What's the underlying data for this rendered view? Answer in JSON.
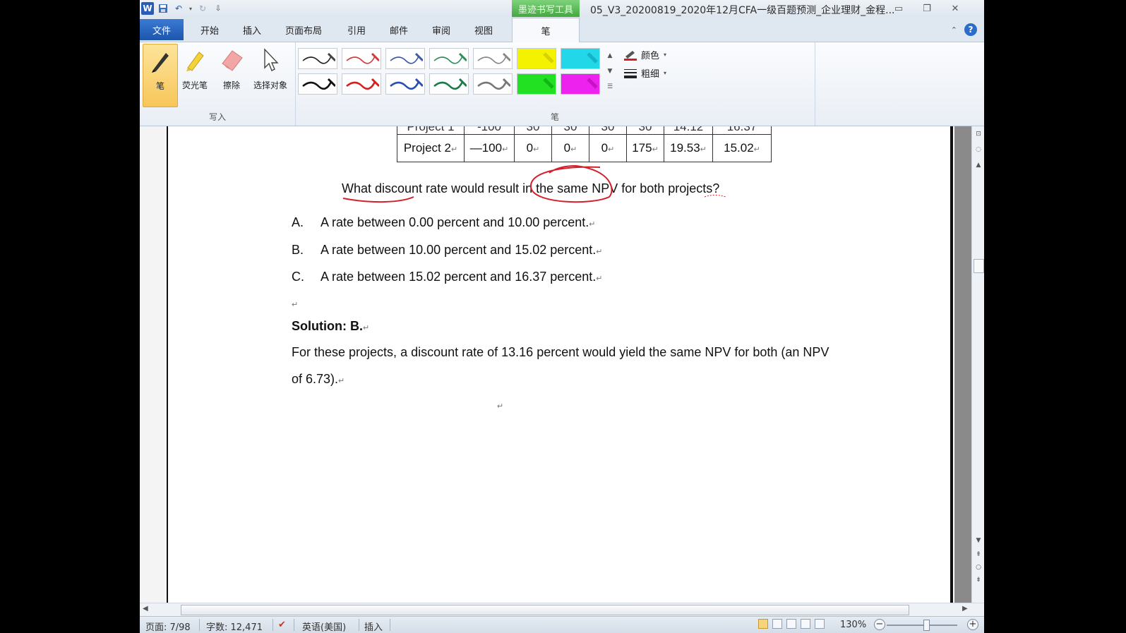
{
  "titlebar": {
    "context_tab": "墨迹书写工具",
    "doc_title": "05_V3_20200819_2020年12月CFA一级百题预测_企业理财_金程..."
  },
  "tabs": {
    "file": "文件",
    "items": [
      "开始",
      "插入",
      "页面布局",
      "引用",
      "邮件",
      "审阅",
      "视图"
    ],
    "active": "笔"
  },
  "ribbon": {
    "write_group": {
      "label": "写入",
      "tools": [
        "笔",
        "荧光笔",
        "擦除",
        "选择对象"
      ]
    },
    "pen_group": {
      "label": "笔",
      "color_label": "颜色",
      "weight_label": "粗细"
    },
    "swatch_colors": {
      "pens_row1": [
        "#222222",
        "#d23a3a",
        "#3a5aa8",
        "#2f8f5a",
        "#888888"
      ],
      "pens_row2": [
        "#111111",
        "#d41f1f",
        "#2a4fb0",
        "#1b7a4a",
        "#777777"
      ],
      "highlighters_row1": [
        "#f5f200",
        "#22d7e8"
      ],
      "highlighters_row2": [
        "#22e022",
        "#ee22ee"
      ]
    }
  },
  "document": {
    "table_partial_row": [
      "Project 1",
      "-100",
      "30",
      "30",
      "30",
      "30",
      "14.12",
      "16.37"
    ],
    "table_row": [
      "Project 2",
      "—100",
      "0",
      "0",
      "0",
      "175",
      "19.53",
      "15.02"
    ],
    "question": {
      "before": "What ",
      "underlined": "discount rate",
      "middle": " would result in th",
      "circle_start": "e",
      "circled": " same NPV",
      "circle_end": " f",
      "after": "or both projects?"
    },
    "options": [
      {
        "letter": "A.",
        "text": "A rate between 0.00 percent and 10.00 percent."
      },
      {
        "letter": "B.",
        "text": "A rate between 10.00 percent and 15.02 percent."
      },
      {
        "letter": "C.",
        "text": "A rate between 15.02 percent and 16.37 percent."
      }
    ],
    "solution": "Solution: B.",
    "explanation_line1": "For these projects, a discount rate of 13.16 percent would yield the same NPV for both (an NPV",
    "explanation_line2": "of 6.73).",
    "mark": "↵"
  },
  "statusbar": {
    "page": "页面: 7/98",
    "words": "字数: 12,471",
    "language": "英语(美国)",
    "mode": "插入",
    "zoom": "130%",
    "zoom_level_percent": 130
  },
  "colors": {
    "accent_blue": "#2b5cb5",
    "context_green": "#4cae47",
    "ink_red": "#d4202a"
  }
}
